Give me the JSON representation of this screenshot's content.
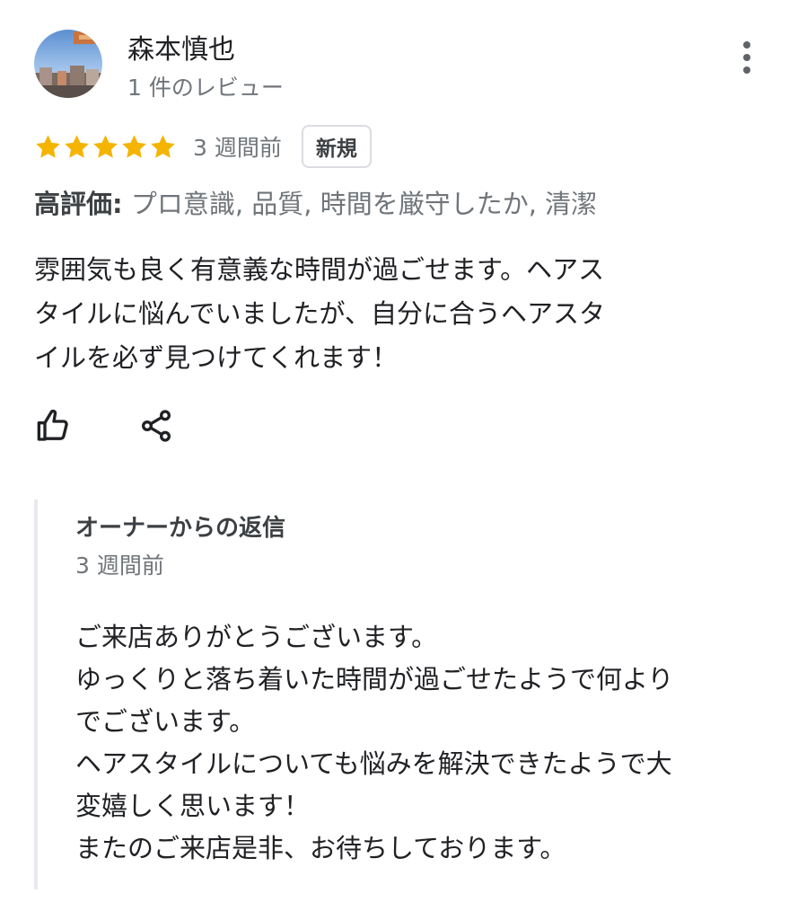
{
  "author": {
    "name": "森本慎也",
    "meta": "1 件のレビュー"
  },
  "more_options_icon": "more-vert-icon",
  "rating": {
    "stars": 5,
    "max": 5,
    "star_color": "#f4b400",
    "time_ago": "3 週間前",
    "badge": "新規"
  },
  "highlights": {
    "label": "高評価:",
    "value": "プロ意識, 品質, 時間を厳守したか, 清潔"
  },
  "review_text": "雰囲気も良く有意義な時間が過ごせます。ヘアス\nタイルに悩んでいましたが、自分に合うヘアスタ\nイルを必ず見つけてくれます！",
  "actions": {
    "like_icon": "thumbs-up-icon",
    "share_icon": "share-icon"
  },
  "owner_reply": {
    "title": "オーナーからの返信",
    "time_ago": "3 週間前",
    "text": "ご来店ありがとうございます。\nゆっくりと落ち着いた時間が過ごせたようで何より\nでございます。\nヘアスタイルについても悩みを解決できたようで大\n変嬉しく思います！\nまたのご来店是非、お待ちしております。"
  }
}
